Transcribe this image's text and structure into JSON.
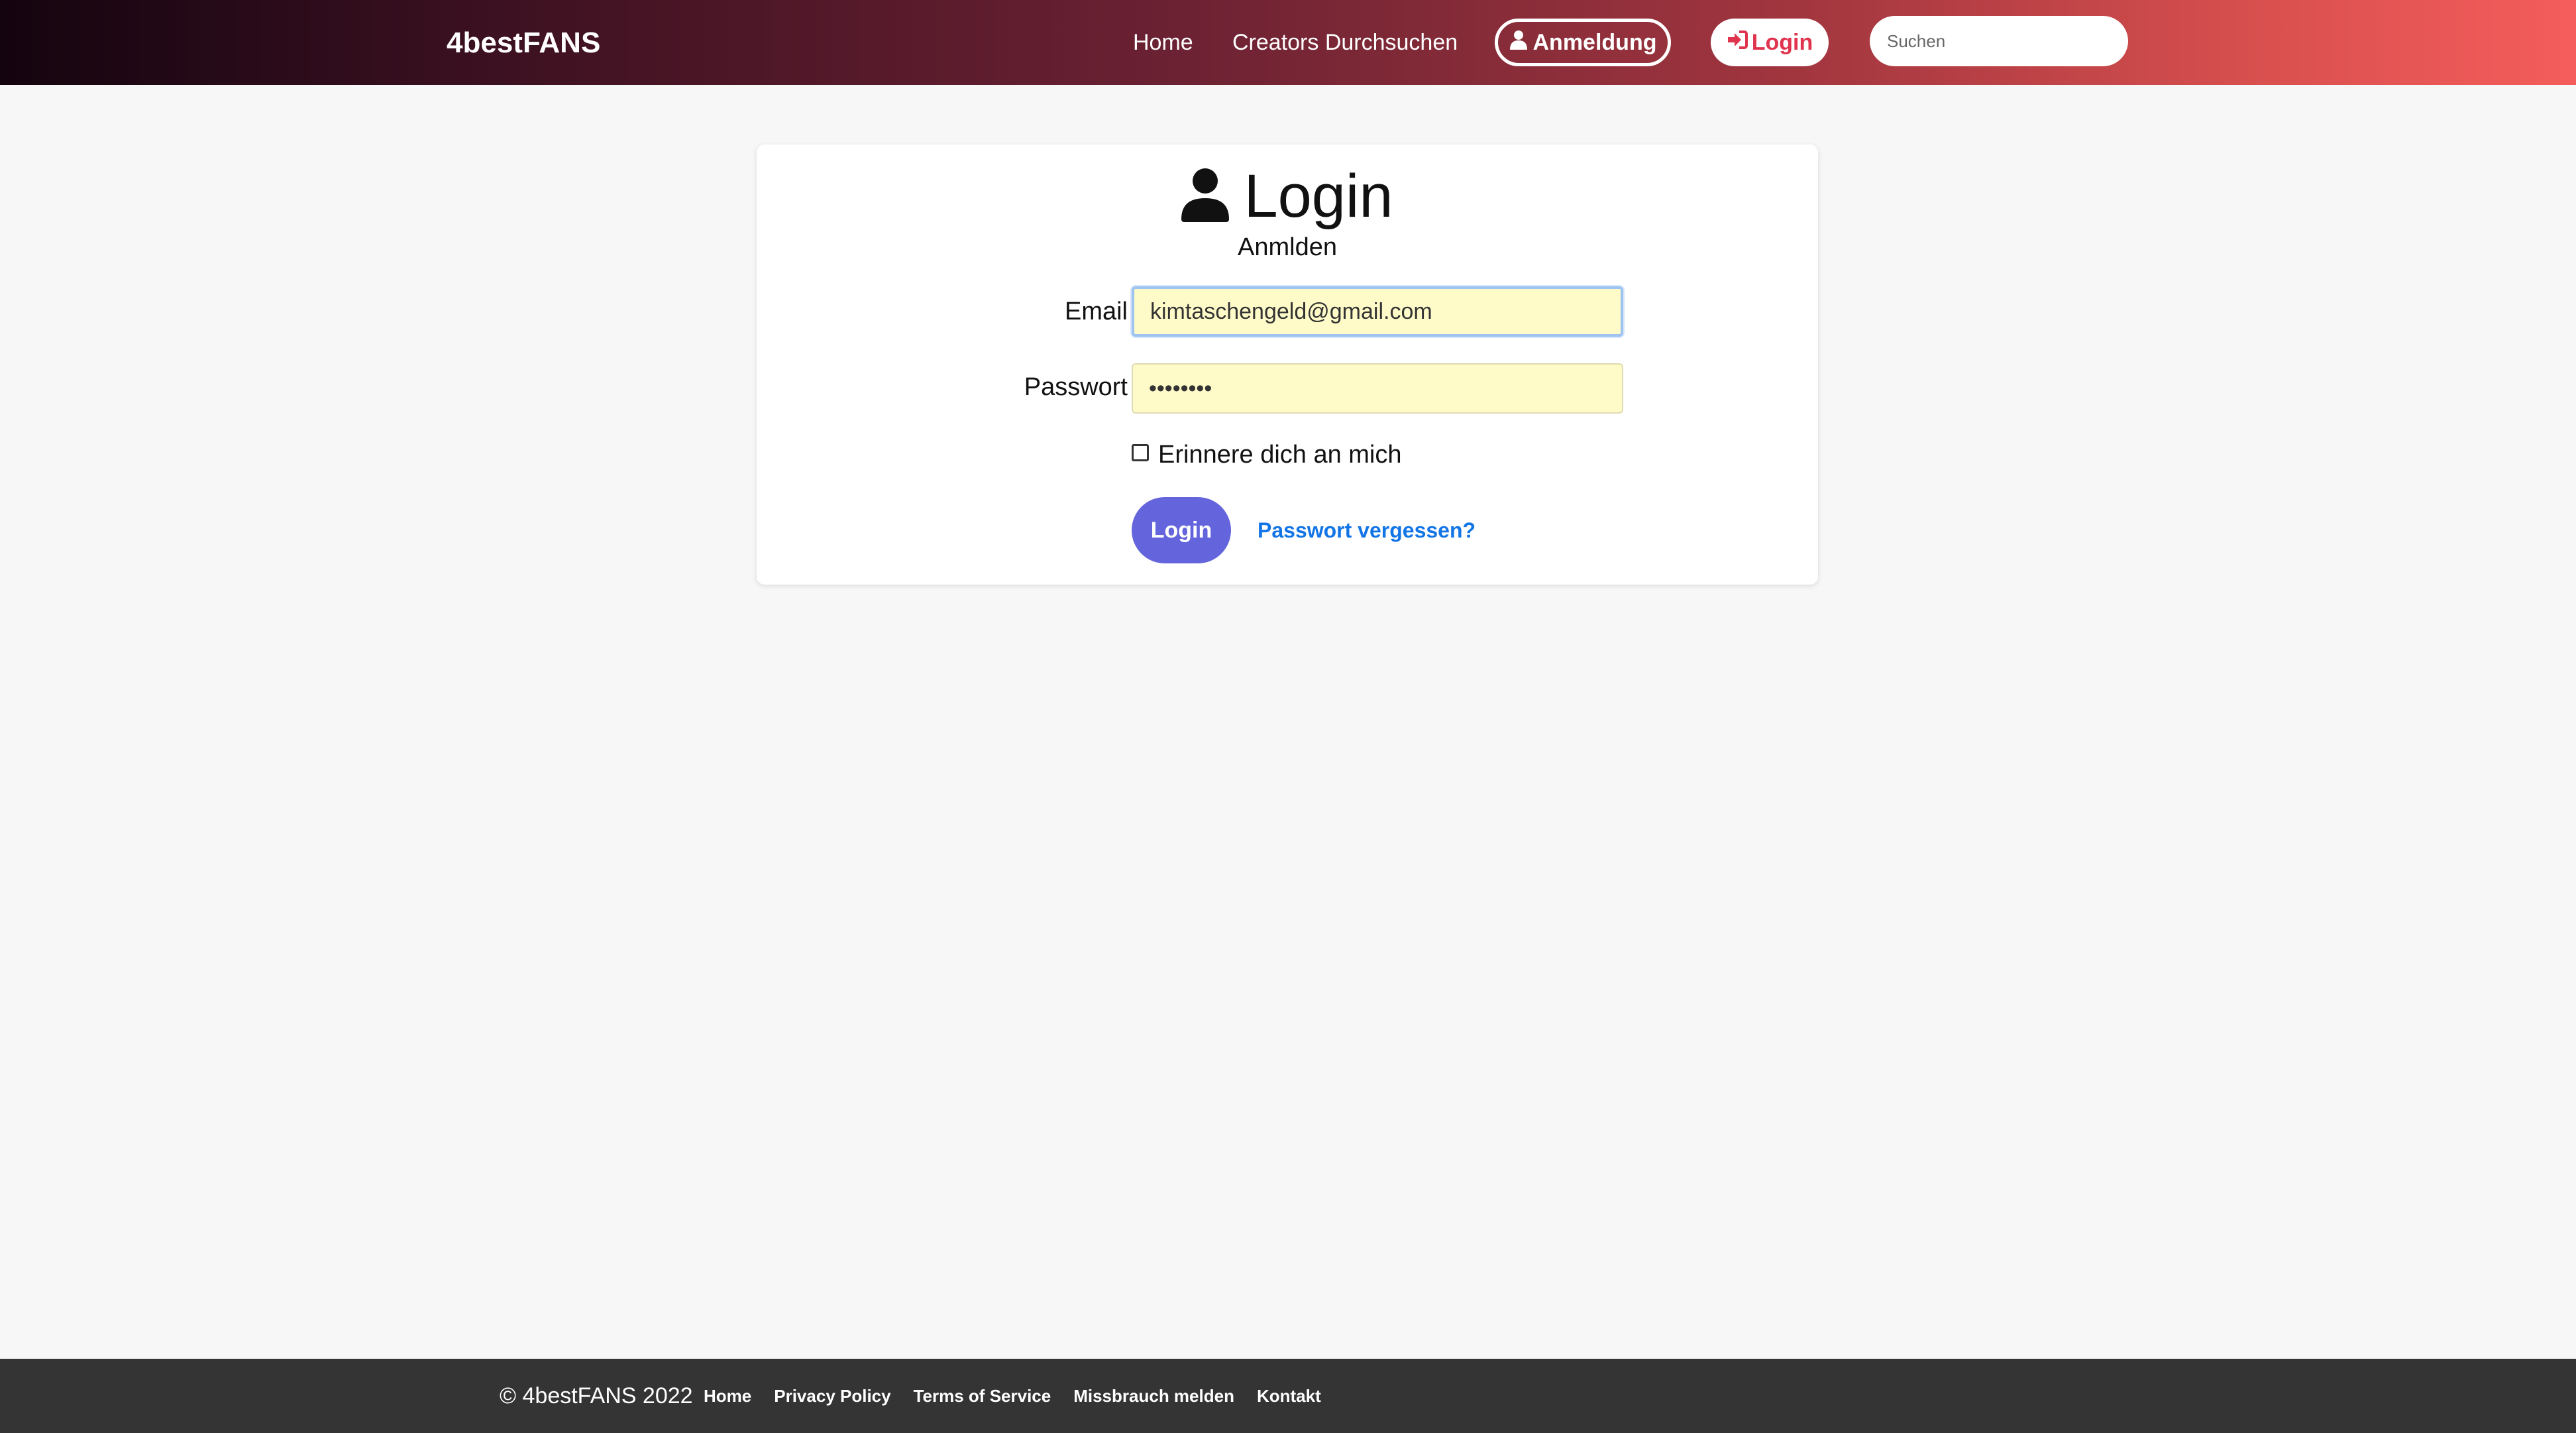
{
  "header": {
    "brand": "4bestFANS",
    "nav": {
      "home": "Home",
      "creators": "Creators Durchsuchen",
      "register": "Anmeldung",
      "login": "Login"
    },
    "search": {
      "placeholder": "Suchen",
      "value": ""
    }
  },
  "login_card": {
    "title": "Login",
    "subtitle": "Anmlden",
    "email_label": "Email",
    "email_value": "kimtaschengeld@gmail.com",
    "password_label": "Passwort",
    "password_value": "password",
    "remember_label": "Erinnere dich an mich",
    "remember_checked": false,
    "submit_label": "Login",
    "forgot_label": "Passwort vergessen?"
  },
  "footer": {
    "copyright": "© 4bestFANS 2022",
    "links": [
      "Home",
      "Privacy Policy",
      "Terms of Service",
      "Missbrauch melden",
      "Kontakt"
    ]
  },
  "colors": {
    "accent_login_text": "#e0344e",
    "submit_button": "#6465dc",
    "link": "#1275e6",
    "footer_bg": "#343434",
    "input_autofill_bg": "#fffbc8"
  },
  "icons": {
    "user": "user-icon",
    "login": "sign-in-icon"
  }
}
